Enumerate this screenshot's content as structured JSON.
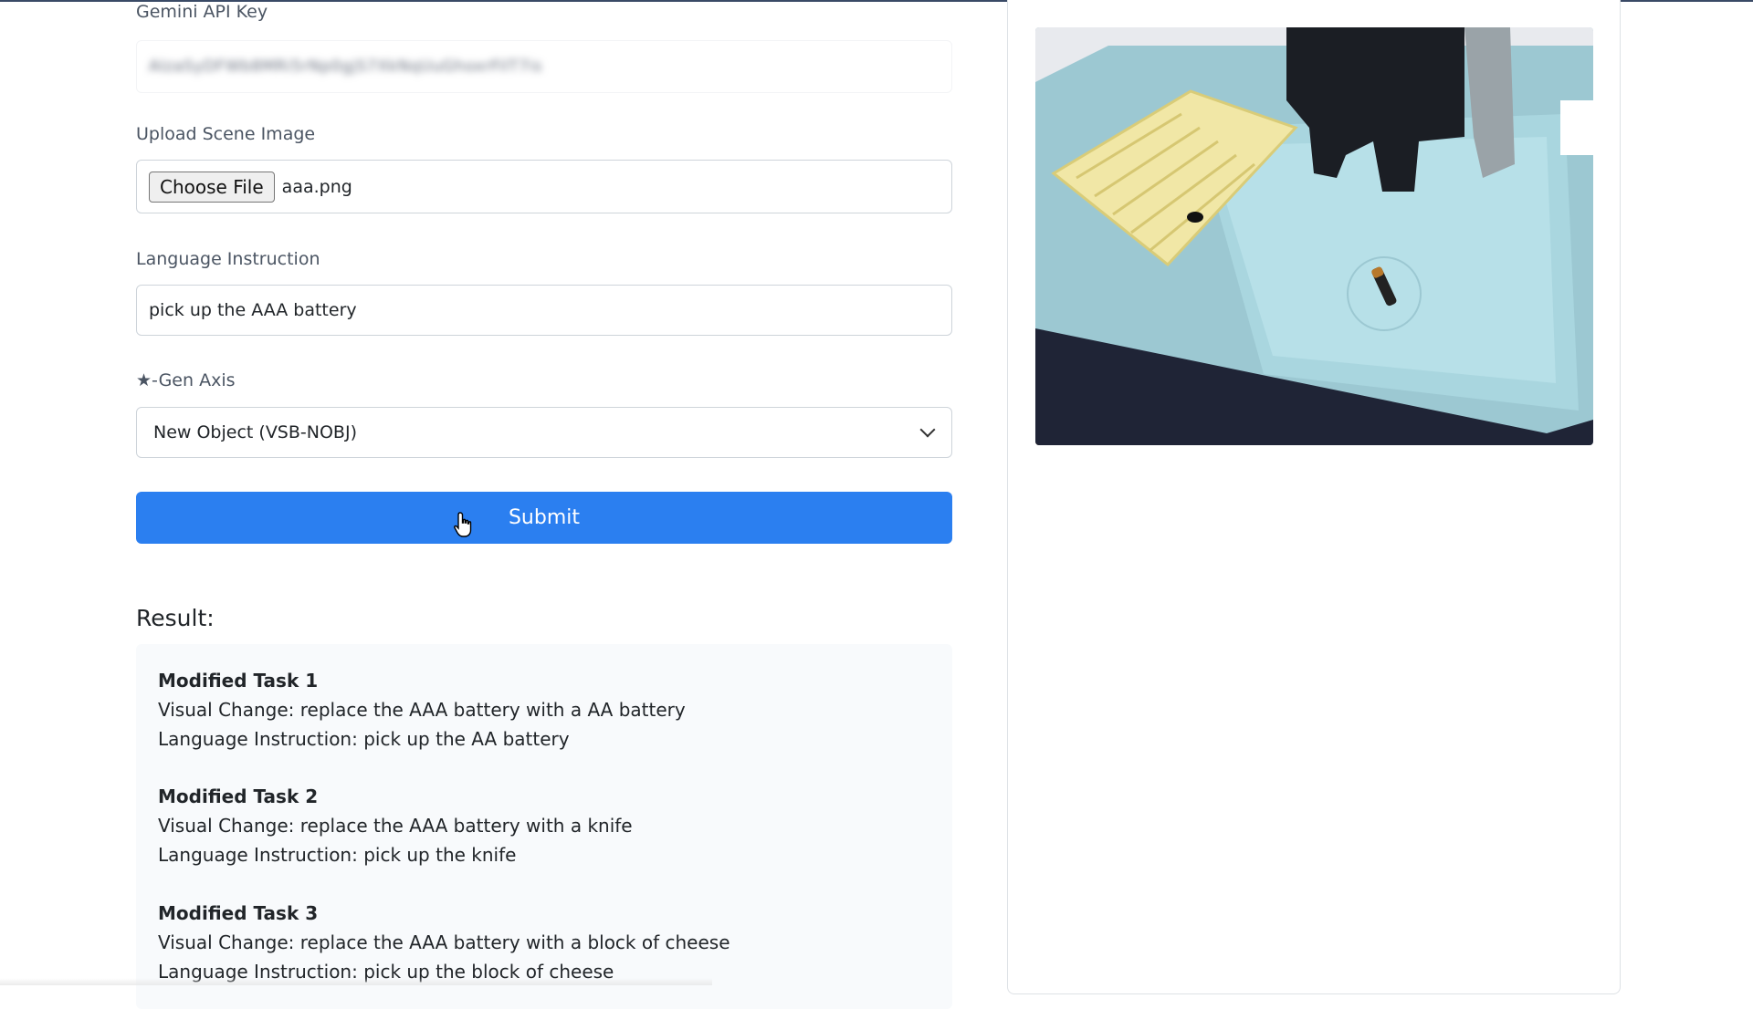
{
  "form": {
    "api_key_label": "Gemini API Key",
    "api_key_value": "AIzaSyDFWb8MRi5rNp0gjS7XkNqUuGhoxrFilT7is",
    "upload_label": "Upload Scene Image",
    "choose_file_label": "Choose File",
    "file_name": "aaa.png",
    "instruction_label": "Language Instruction",
    "instruction_value": "pick up the AAA battery",
    "gen_axis_label": "★-Gen Axis",
    "gen_axis_selected": "New Object (VSB-NOBJ)",
    "submit_label": "Submit"
  },
  "result": {
    "title": "Result:",
    "tasks": [
      {
        "title": "Modified Task 1",
        "visual_change": "Visual Change: replace the AAA battery with a AA battery",
        "instruction": "Language Instruction: pick up the AA battery"
      },
      {
        "title": "Modified Task 2",
        "visual_change": "Visual Change: replace the AAA battery with a knife",
        "instruction": "Language Instruction: pick up the knife"
      },
      {
        "title": "Modified Task 3",
        "visual_change": "Visual Change: replace the AAA battery with a block of cheese",
        "instruction": "Language Instruction: pick up the block of cheese"
      }
    ]
  },
  "colors": {
    "submit_bg": "#2b7ff0",
    "result_bg": "#f8fafc"
  }
}
